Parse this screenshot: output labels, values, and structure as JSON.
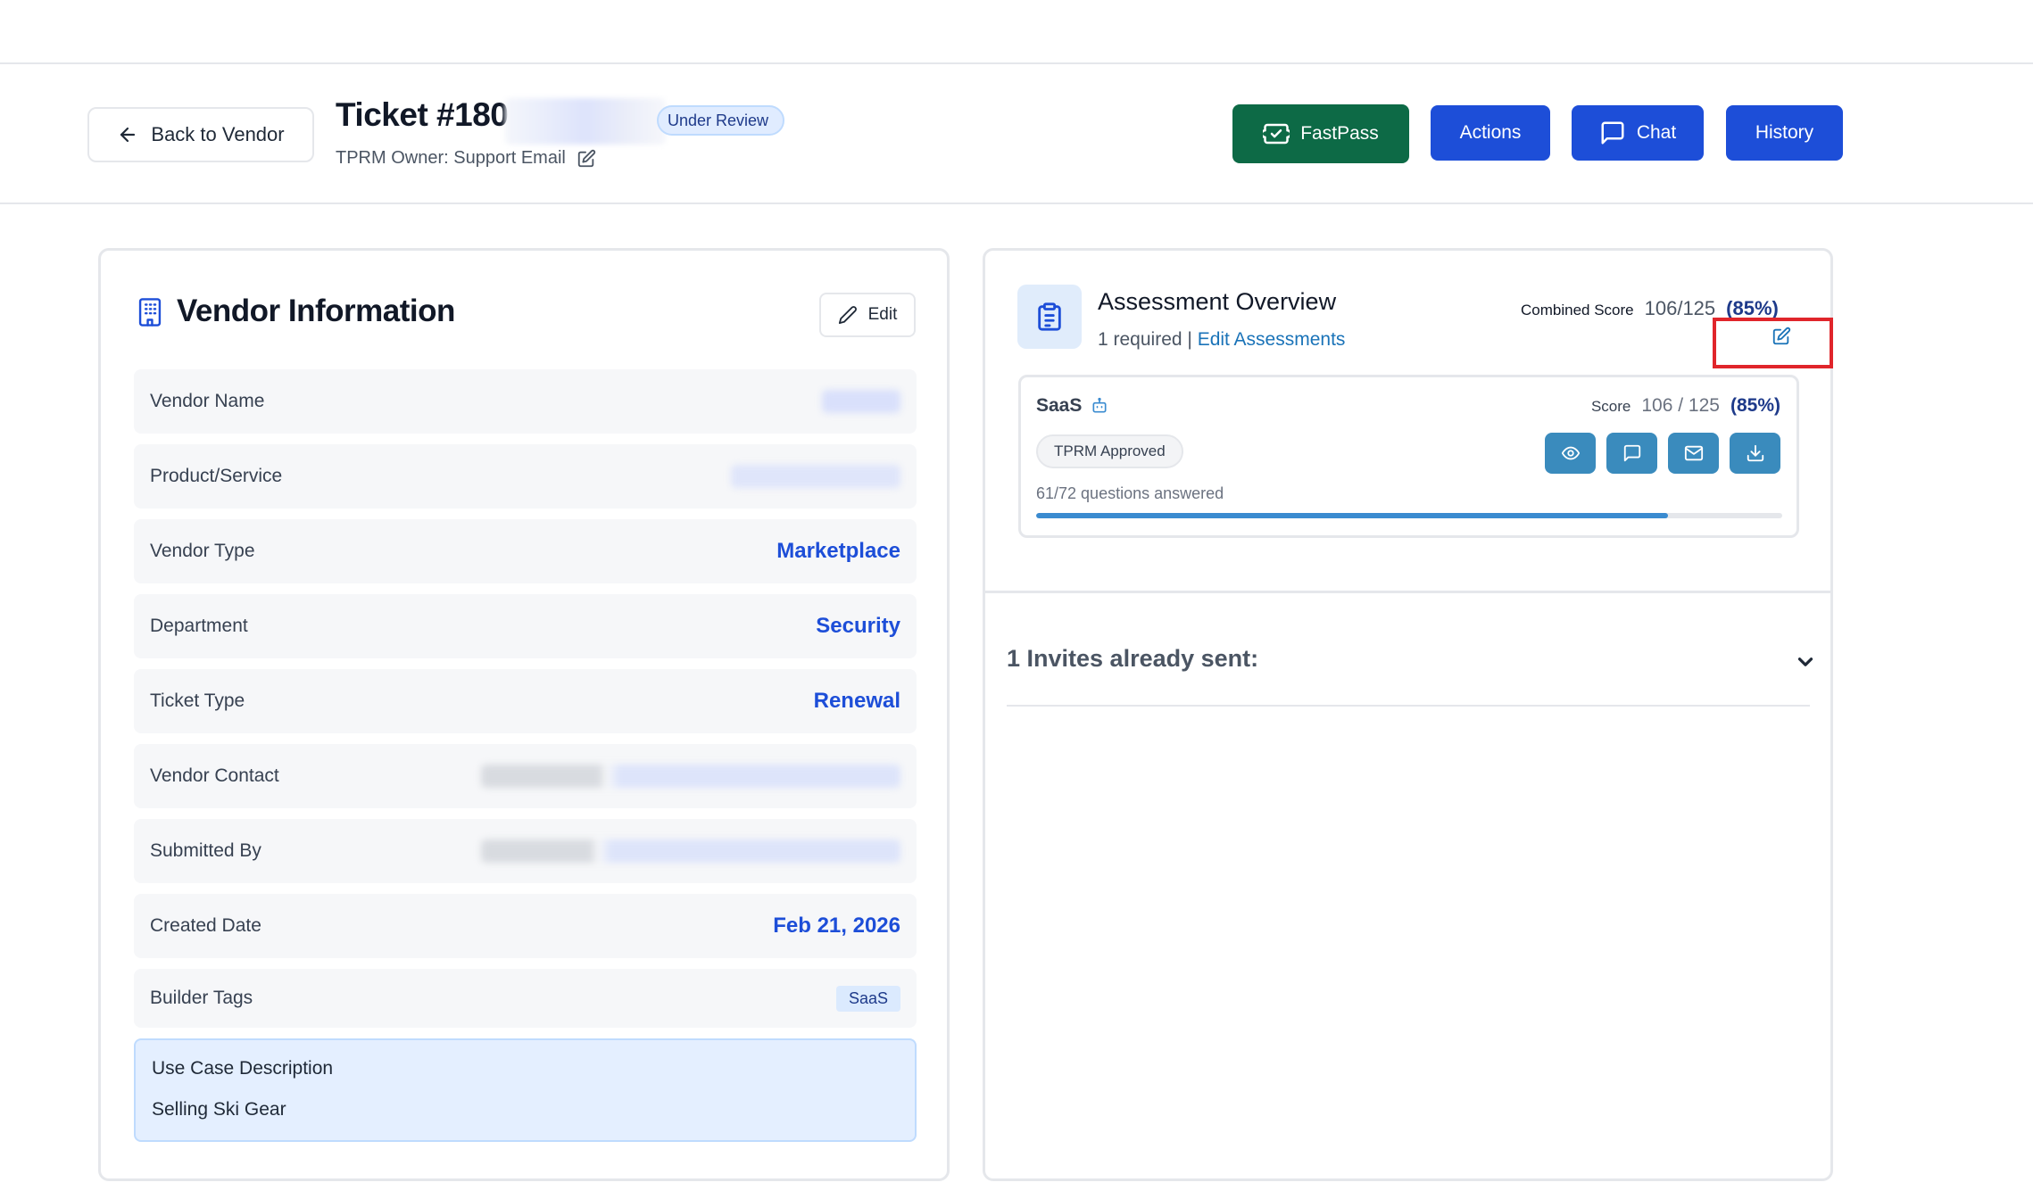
{
  "header": {
    "back_label": "Back to Vendor",
    "ticket_title": "Ticket #180",
    "status": "Under Review",
    "owner": "TPRM Owner: Support Email",
    "buttons": {
      "fastpass": "FastPass",
      "actions": "Actions",
      "chat": "Chat",
      "history": "History"
    }
  },
  "vendor": {
    "title": "Vendor Information",
    "edit_label": "Edit",
    "rows": [
      {
        "label": "Vendor Name",
        "value": ""
      },
      {
        "label": "Product/Service",
        "value": ""
      },
      {
        "label": "Vendor Type",
        "value": "Marketplace"
      },
      {
        "label": "Department",
        "value": "Security"
      },
      {
        "label": "Ticket Type",
        "value": "Renewal"
      },
      {
        "label": "Vendor Contact",
        "value": ""
      },
      {
        "label": "Submitted By",
        "value": ""
      },
      {
        "label": "Created Date",
        "value": "Feb 21, 2026"
      },
      {
        "label": "Builder Tags",
        "value": "SaaS"
      }
    ],
    "use_case": {
      "label": "Use Case Description",
      "value": "Selling Ski Gear"
    }
  },
  "assessment": {
    "title": "Assessment Overview",
    "required": "1 required",
    "separator": " | ",
    "edit_link": "Edit Assessments",
    "combined_label": "Combined Score",
    "combined_value": "106/125",
    "combined_pct": "(85%)",
    "item": {
      "name": "SaaS",
      "score_label": "Score",
      "score_value": "106 / 125",
      "score_pct": "(85%)",
      "status": "TPRM Approved",
      "answered": "61/72 questions answered",
      "progress": 0.847
    },
    "invites": "1 Invites already sent:"
  },
  "icons": [
    "arrow-left-icon",
    "edit-icon",
    "ticket-icon",
    "chat-icon",
    "building-icon",
    "pencil-icon",
    "clipboard-icon",
    "bot-icon",
    "eye-icon",
    "message-icon",
    "mail-icon",
    "download-icon",
    "chevron-down-icon"
  ],
  "colors": {
    "primary": "#1d4ed8",
    "fastpass": "#0d6a46",
    "action_icon": "#3a8bbd",
    "highlight": "#e0252b",
    "link": "#1a73b8"
  }
}
